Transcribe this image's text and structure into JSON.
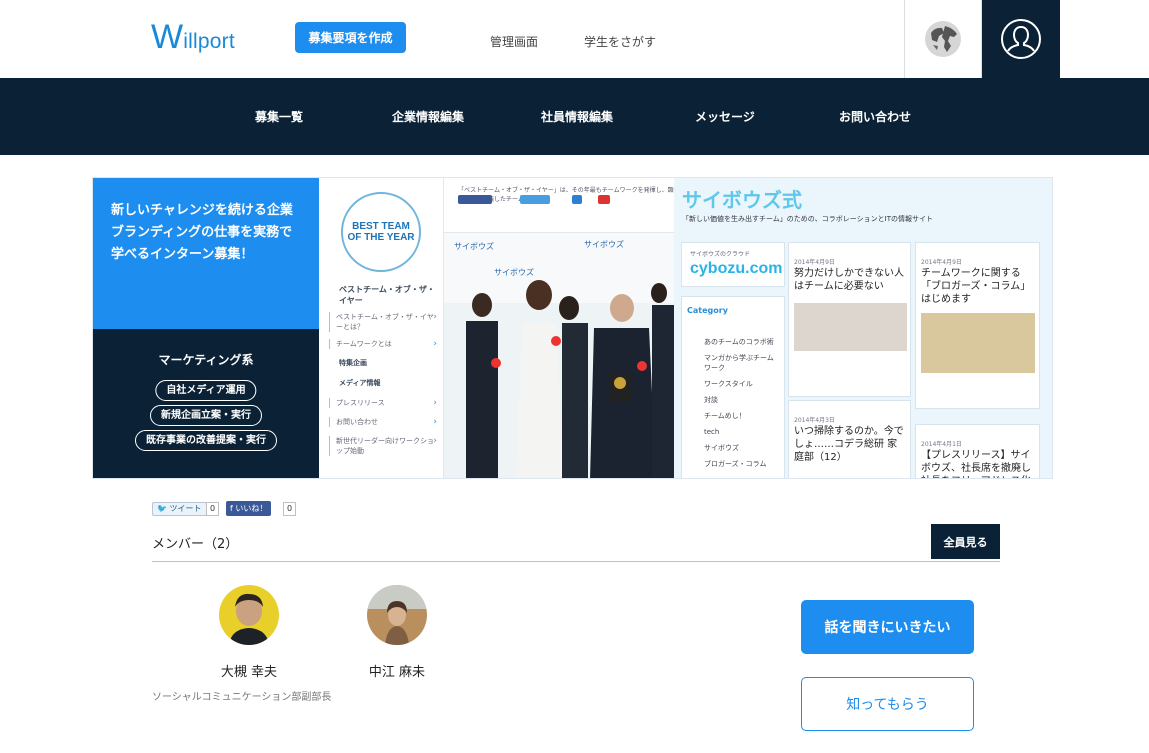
{
  "header": {
    "logo_initial": "W",
    "logo_rest": "illport",
    "create_button": "募集要項を作成",
    "links": [
      "管理画面",
      "学生をさがす"
    ],
    "globe_icon": "globe-icon",
    "user_icon": "user-icon"
  },
  "nav": {
    "items": [
      "募集一覧",
      "企業情報編集",
      "社員情報編集",
      "メッセージ",
      "お問い合わせ"
    ]
  },
  "banner": {
    "headline_lines": [
      "新しいチャレンジを続ける企業",
      "ブランディングの仕事を実務で",
      "学べるインターン募集！"
    ],
    "category": "マーケティング系",
    "tags": [
      "自社メディア運用",
      "新規企画立案・実行",
      "既存事業の改善提案・実行"
    ],
    "badge_line1": "BEST TEAM",
    "badge_line2": "OF THE YEAR",
    "side_items": [
      "ベストチーム・オブ・ザ・イヤー",
      "ベストチーム・オブ・ザ・イヤーとは？",
      "チームワークとは",
      "特集企画",
      "メディア情報",
      "プレスリリース",
      "お問い合わせ",
      "新世代リーダー向けワークショップ始動"
    ],
    "mid_caption": "「ベストチーム・オブ・ザ・イヤー」は、その年最もチームワークを発揮し、顕著な業績を残したチームを",
    "site_title": "サイボウズ式",
    "site_subtitle": "「新しい価値を生み出すチーム」のための、コラボレーションとITの情報サイト",
    "cybozu_label": "サイボウズのクラウド",
    "cybozu_logo": "cybozu.com",
    "category_heading": "Category",
    "categories": [
      "あのチームのコラボ術",
      "マンガから学ぶチームワーク",
      "ワークスタイル",
      "対談",
      "チームめし！",
      "tech",
      "サイボウズ",
      "ブロガーズ・コラム"
    ],
    "cards": [
      {
        "date": "2014年4月9日",
        "title": "努力だけしかできない人はチームに必要ない"
      },
      {
        "date": "2014年4月9日",
        "title": "チームワークに関する「ブロガーズ・コラム」はじめます"
      },
      {
        "date": "2014年4月3日",
        "title": "いつ掃除するのか。今でしょ……コデラ総研 家庭部（12）"
      },
      {
        "date": "2014年4月1日",
        "title": "【プレスリリース】サイボウズ、社長席を撤廃し社長をフリーアドレス化"
      }
    ]
  },
  "social": {
    "tweet_label": "ツイート",
    "tweet_count": "0",
    "like_label": "いいね！",
    "like_count": "0"
  },
  "members": {
    "title": "メンバー（2）",
    "all_button": "全員見る",
    "list": [
      {
        "name": "大槻 幸夫",
        "role": "ソーシャルコミュニケーション部副部長"
      },
      {
        "name": "中江 麻未",
        "role": ""
      }
    ]
  },
  "cta": {
    "primary": "話を聞きにいきたい",
    "secondary": "知ってもらう"
  },
  "colors": {
    "brand_blue": "#1d8df0",
    "navy": "#0b2236"
  }
}
